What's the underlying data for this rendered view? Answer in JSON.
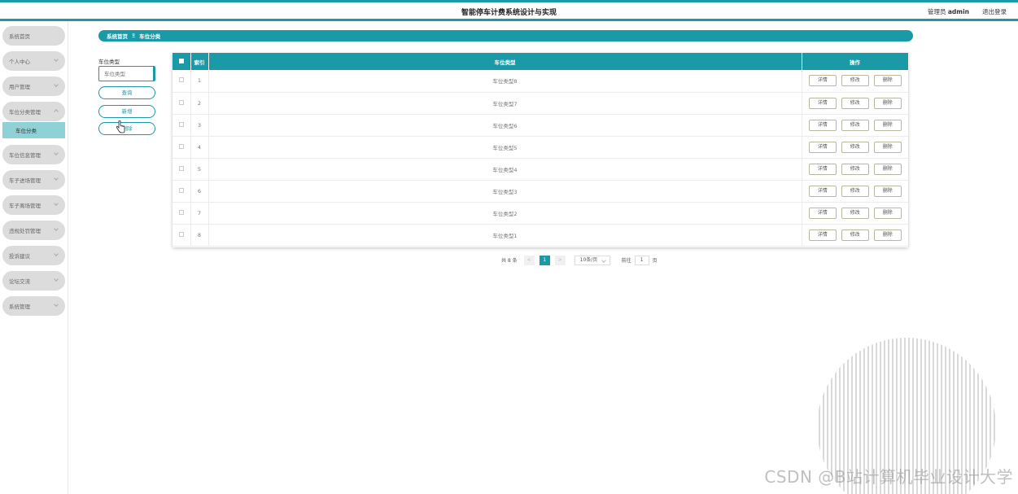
{
  "header": {
    "app_title": "智能停车计费系统设计与实现",
    "user_prefix": "管理员",
    "username": "admin",
    "logout_label": "退出登录"
  },
  "sidebar": {
    "items": [
      {
        "label": "系统首页",
        "expandable": false
      },
      {
        "label": "个人中心",
        "expandable": true
      },
      {
        "label": "用户管理",
        "expandable": true
      },
      {
        "label": "车位分类管理",
        "expandable": true,
        "expanded": true
      },
      {
        "label": "车位信息管理",
        "expandable": true
      },
      {
        "label": "车子进场管理",
        "expandable": true
      },
      {
        "label": "车子离场管理",
        "expandable": true
      },
      {
        "label": "违规处罚管理",
        "expandable": true
      },
      {
        "label": "投诉建议",
        "expandable": true
      },
      {
        "label": "论坛交流",
        "expandable": true
      },
      {
        "label": "系统管理",
        "expandable": true
      }
    ],
    "active_submenu": "车位分类"
  },
  "breadcrumb": {
    "home": "系统首页",
    "separator": "Ξ",
    "current": "车位分类"
  },
  "filter": {
    "label": "车位类型",
    "placeholder": "车位类型",
    "search_label": "查询",
    "add_label": "新增",
    "delete_label": "删除"
  },
  "table": {
    "columns": [
      "",
      "索引",
      "车位类型",
      "操作"
    ],
    "rows": [
      {
        "index": "1",
        "type": "车位类型8"
      },
      {
        "index": "2",
        "type": "车位类型7"
      },
      {
        "index": "3",
        "type": "车位类型6"
      },
      {
        "index": "4",
        "type": "车位类型5"
      },
      {
        "index": "5",
        "type": "车位类型4"
      },
      {
        "index": "6",
        "type": "车位类型3"
      },
      {
        "index": "7",
        "type": "车位类型2"
      },
      {
        "index": "8",
        "type": "车位类型1"
      }
    ],
    "row_actions": {
      "detail": "详情",
      "edit": "修改",
      "delete": "删除"
    }
  },
  "pagination": {
    "total_text": "共 8 条",
    "prev": "<",
    "current_page": "1",
    "next": ">",
    "page_size": "10条/页",
    "goto_prefix": "前往",
    "goto_value": "1",
    "goto_suffix": "页"
  },
  "watermark": "CSDN @B站计算机毕业设计大学",
  "colors": {
    "accent": "#1a9aa6",
    "submenu_active": "#8ed1d6",
    "menu_bg": "#dcdcdc"
  }
}
